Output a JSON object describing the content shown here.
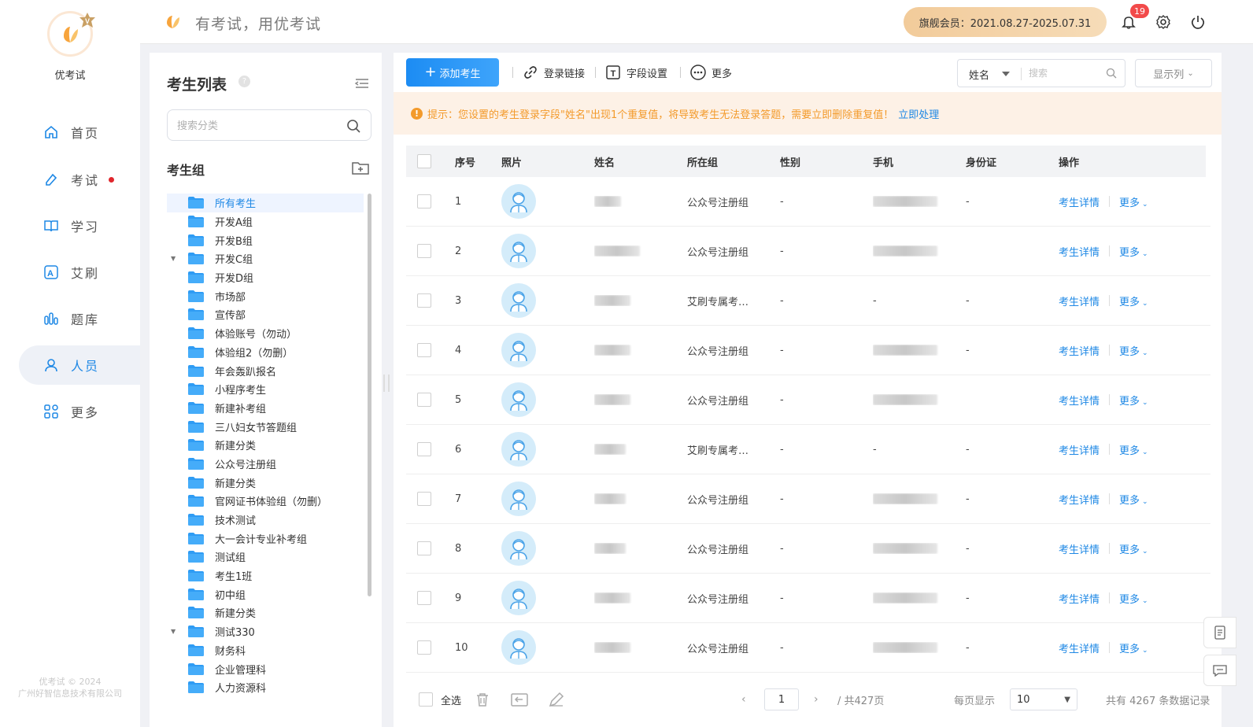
{
  "app": {
    "name": "优考试",
    "slogan": "有考试，用优考试",
    "copyright_line1": "优考试 © 2024",
    "copyright_line2": "广州好智信息技术有限公司"
  },
  "header": {
    "member": "旗舰会员：2021.08.27-2025.07.31",
    "notification_count": "19"
  },
  "nav": [
    {
      "label": "首页",
      "icon": "home-icon"
    },
    {
      "label": "考试",
      "icon": "exam-icon",
      "dot": true
    },
    {
      "label": "学习",
      "icon": "book-icon"
    },
    {
      "label": "艾刷",
      "icon": "a-icon"
    },
    {
      "label": "题库",
      "icon": "chart-icon"
    },
    {
      "label": "人员",
      "icon": "user-icon",
      "active": true
    },
    {
      "label": "更多",
      "icon": "apps-icon"
    }
  ],
  "category": {
    "title": "考生列表",
    "search_placeholder": "搜索分类",
    "group_title": "考生组",
    "items": [
      {
        "label": "所有考生",
        "selected": true
      },
      {
        "label": "开发A组"
      },
      {
        "label": "开发B组"
      },
      {
        "label": "开发C组",
        "expandable": true
      },
      {
        "label": "开发D组"
      },
      {
        "label": "市场部"
      },
      {
        "label": "宣传部"
      },
      {
        "label": "体验账号（勿动）"
      },
      {
        "label": "体验组2（勿删）"
      },
      {
        "label": "年会轰趴报名"
      },
      {
        "label": "小程序考生"
      },
      {
        "label": "新建补考组"
      },
      {
        "label": "三八妇女节答题组"
      },
      {
        "label": "新建分类"
      },
      {
        "label": "公众号注册组"
      },
      {
        "label": "新建分类"
      },
      {
        "label": "官网证书体验组（勿删）"
      },
      {
        "label": "技术测试"
      },
      {
        "label": "大一会计专业补考组"
      },
      {
        "label": "测试组"
      },
      {
        "label": "考生1班"
      },
      {
        "label": "初中组"
      },
      {
        "label": "新建分类"
      },
      {
        "label": "测试330",
        "expandable": true
      },
      {
        "label": "财务科"
      },
      {
        "label": "企业管理科"
      },
      {
        "label": "人力资源科"
      }
    ]
  },
  "toolbar": {
    "add_label": "添加考生",
    "login_link_label": "登录链接",
    "field_settings_label": "字段设置",
    "more_label": "更多",
    "filter_field": "姓名",
    "search_placeholder": "搜索",
    "columns_label": "显示列"
  },
  "warning": {
    "text": "提示：您设置的考生登录字段\"姓名\"出现1个重复值，将导致考生无法登录答题，需要立即删除重复值！",
    "link": "立即处理"
  },
  "table": {
    "headers": [
      "序号",
      "照片",
      "姓名",
      "所在组",
      "性别",
      "手机",
      "身份证",
      "操作"
    ],
    "detail_label": "考生详情",
    "more_label": "更多",
    "rows": [
      {
        "no": "1",
        "group": "公众号注册组",
        "gender": "-",
        "phone": "",
        "id": "-"
      },
      {
        "no": "2",
        "group": "公众号注册组",
        "gender": "-",
        "phone": "",
        "id": ""
      },
      {
        "no": "3",
        "group": "艾刷专属考生组",
        "gender": "-",
        "phone": "-",
        "id": "-"
      },
      {
        "no": "4",
        "group": "公众号注册组",
        "gender": "-",
        "phone": "",
        "id": "-"
      },
      {
        "no": "5",
        "group": "公众号注册组",
        "gender": "-",
        "phone": "",
        "id": ""
      },
      {
        "no": "6",
        "group": "艾刷专属考生组",
        "gender": "-",
        "phone": "-",
        "id": "-"
      },
      {
        "no": "7",
        "group": "公众号注册组",
        "gender": "-",
        "phone": "",
        "id": "-"
      },
      {
        "no": "8",
        "group": "公众号注册组",
        "gender": "-",
        "phone": "",
        "id": "-"
      },
      {
        "no": "9",
        "group": "公众号注册组",
        "gender": "-",
        "phone": "",
        "id": "-"
      },
      {
        "no": "10",
        "group": "公众号注册组",
        "gender": "-",
        "phone": "",
        "id": "-"
      }
    ]
  },
  "footer": {
    "select_all": "全选",
    "current_page": "1",
    "total_pages": "/ 共427页",
    "per_page_label": "每页显示",
    "per_page_value": "10",
    "total_records": "共有 4267 条数据记录"
  },
  "colors": {
    "primary": "#1e88e5",
    "warning": "#f39a2b",
    "badge": "#f24a4a"
  }
}
